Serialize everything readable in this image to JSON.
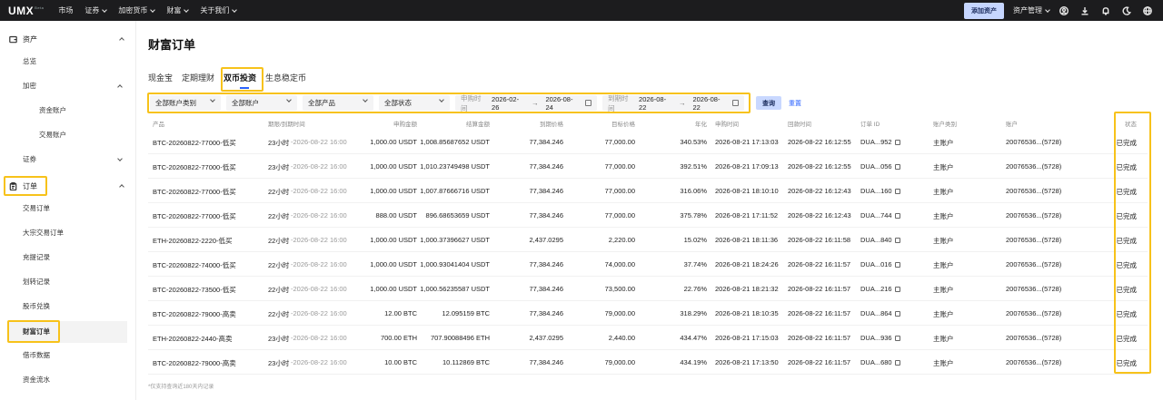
{
  "topnav": {
    "logo": "UMX",
    "logo_badge": "Beta",
    "menu": [
      {
        "label": "市场",
        "has_dropdown": false
      },
      {
        "label": "证券",
        "has_dropdown": true
      },
      {
        "label": "加密货币",
        "has_dropdown": true
      },
      {
        "label": "财富",
        "has_dropdown": true
      },
      {
        "label": "关于我们",
        "has_dropdown": true
      }
    ],
    "add_asset_label": "添加资产",
    "asset_mgmt_label": "资产管理",
    "icons": [
      "user-icon",
      "download-icon",
      "bell-icon",
      "moon-icon",
      "globe-icon"
    ]
  },
  "sidebar": {
    "asset_group": "资产",
    "overview": "总览",
    "crypto_group": "加密",
    "fund_account": "资金账户",
    "trade_account": "交易账户",
    "securities_group": "证券",
    "orders_group": "订单",
    "order_items": [
      "交易订单",
      "大宗交易订单",
      "充提记录",
      "划转记录",
      "股币兑换",
      "财富订单",
      "借币数据",
      "资金流水"
    ],
    "active_item": "财富订单"
  },
  "main": {
    "title": "财富订单",
    "tabs": [
      "现金宝",
      "定期理财",
      "双币投资",
      "生息稳定币"
    ],
    "active_tab": "双币投资",
    "filters": {
      "account_type": "全部账户类别",
      "account": "全部账户",
      "product": "全部产品",
      "status": "全部状态",
      "subscribe_label": "申购时间",
      "subscribe_from": "2026-02-26",
      "subscribe_to": "2026-08-24",
      "expire_label": "到期时间",
      "expire_from": "2026-08-22",
      "expire_to": "2026-08-22",
      "arrow": "→",
      "query_label": "查询",
      "reset_label": "重置"
    },
    "table": {
      "headers": [
        "产品",
        "期限/到期时间",
        "申购金额",
        "结算金额",
        "到期价格",
        "目标价格",
        "年化",
        "申购时间",
        "回款时间",
        "订单 ID",
        "账户类别",
        "账户",
        "状态"
      ],
      "rows": [
        {
          "product": "BTC-20260822-77000-低买",
          "term": "23小时",
          "expire": "2026-08-22 16:00",
          "amount": "1,000.00 USDT",
          "settle": "1,008.85687652 USDT",
          "expiry_price": "77,384.246",
          "target": "77,000.00",
          "apy": "340.53%",
          "sub_time": "2026-08-21 17:13:03",
          "pay_time": "2026-08-22 16:12:55",
          "order_id": "DUA...952",
          "acct_type": "主账户",
          "account": "20076536...(5728)",
          "status": "已完成"
        },
        {
          "product": "BTC-20260822-77000-低买",
          "term": "23小时",
          "expire": "2026-08-22 16:00",
          "amount": "1,000.00 USDT",
          "settle": "1,010.23749498 USDT",
          "expiry_price": "77,384.246",
          "target": "77,000.00",
          "apy": "392.51%",
          "sub_time": "2026-08-21 17:09:13",
          "pay_time": "2026-08-22 16:12:55",
          "order_id": "DUA...056",
          "acct_type": "主账户",
          "account": "20076536...(5728)",
          "status": "已完成"
        },
        {
          "product": "BTC-20260822-77000-低买",
          "term": "22小时",
          "expire": "2026-08-22 16:00",
          "amount": "1,000.00 USDT",
          "settle": "1,007.87666716 USDT",
          "expiry_price": "77,384.246",
          "target": "77,000.00",
          "apy": "316.06%",
          "sub_time": "2026-08-21 18:10:10",
          "pay_time": "2026-08-22 16:12:43",
          "order_id": "DUA...160",
          "acct_type": "主账户",
          "account": "20076536...(5728)",
          "status": "已完成"
        },
        {
          "product": "BTC-20260822-77000-低买",
          "term": "22小时",
          "expire": "2026-08-22 16:00",
          "amount": "888.00 USDT",
          "settle": "896.68653659 USDT",
          "expiry_price": "77,384.246",
          "target": "77,000.00",
          "apy": "375.78%",
          "sub_time": "2026-08-21 17:11:52",
          "pay_time": "2026-08-22 16:12:43",
          "order_id": "DUA...744",
          "acct_type": "主账户",
          "account": "20076536...(5728)",
          "status": "已完成"
        },
        {
          "product": "ETH-20260822-2220-低买",
          "term": "22小时",
          "expire": "2026-08-22 16:00",
          "amount": "1,000.00 USDT",
          "settle": "1,000.37396627 USDT",
          "expiry_price": "2,437.0295",
          "target": "2,220.00",
          "apy": "15.02%",
          "sub_time": "2026-08-21 18:11:36",
          "pay_time": "2026-08-22 16:11:58",
          "order_id": "DUA...840",
          "acct_type": "主账户",
          "account": "20076536...(5728)",
          "status": "已完成"
        },
        {
          "product": "BTC-20260822-74000-低买",
          "term": "22小时",
          "expire": "2026-08-22 16:00",
          "amount": "1,000.00 USDT",
          "settle": "1,000.93041404 USDT",
          "expiry_price": "77,384.246",
          "target": "74,000.00",
          "apy": "37.74%",
          "sub_time": "2026-08-21 18:24:26",
          "pay_time": "2026-08-22 16:11:57",
          "order_id": "DUA...016",
          "acct_type": "主账户",
          "account": "20076536...(5728)",
          "status": "已完成"
        },
        {
          "product": "BTC-20260822-73500-低买",
          "term": "22小时",
          "expire": "2026-08-22 16:00",
          "amount": "1,000.00 USDT",
          "settle": "1,000.56235587 USDT",
          "expiry_price": "77,384.246",
          "target": "73,500.00",
          "apy": "22.76%",
          "sub_time": "2026-08-21 18:21:32",
          "pay_time": "2026-08-22 16:11:57",
          "order_id": "DUA...216",
          "acct_type": "主账户",
          "account": "20076536...(5728)",
          "status": "已完成"
        },
        {
          "product": "BTC-20260822-79000-高卖",
          "term": "22小时",
          "expire": "2026-08-22 16:00",
          "amount": "12.00 BTC",
          "settle": "12.095159 BTC",
          "expiry_price": "77,384.246",
          "target": "79,000.00",
          "apy": "318.29%",
          "sub_time": "2026-08-21 18:10:35",
          "pay_time": "2026-08-22 16:11:57",
          "order_id": "DUA...864",
          "acct_type": "主账户",
          "account": "20076536...(5728)",
          "status": "已完成"
        },
        {
          "product": "ETH-20260822-2440-高卖",
          "term": "23小时",
          "expire": "2026-08-22 16:00",
          "amount": "700.00 ETH",
          "settle": "707.90088496 ETH",
          "expiry_price": "2,437.0295",
          "target": "2,440.00",
          "apy": "434.47%",
          "sub_time": "2026-08-21 17:15:03",
          "pay_time": "2026-08-22 16:11:57",
          "order_id": "DUA...936",
          "acct_type": "主账户",
          "account": "20076536...(5728)",
          "status": "已完成"
        },
        {
          "product": "BTC-20260822-79000-高卖",
          "term": "23小时",
          "expire": "2026-08-22 16:00",
          "amount": "10.00 BTC",
          "settle": "10.112869 BTC",
          "expiry_price": "77,384.246",
          "target": "79,000.00",
          "apy": "434.19%",
          "sub_time": "2026-08-21 17:13:50",
          "pay_time": "2026-08-22 16:11:57",
          "order_id": "DUA...680",
          "acct_type": "主账户",
          "account": "20076536...(5728)",
          "status": "已完成"
        }
      ]
    },
    "footnote": "*仅支持查询近180天内记录"
  },
  "colors": {
    "accent": "#2b63ff",
    "highlight": "#f7c21a",
    "nav_bg": "#1c1c1e"
  }
}
